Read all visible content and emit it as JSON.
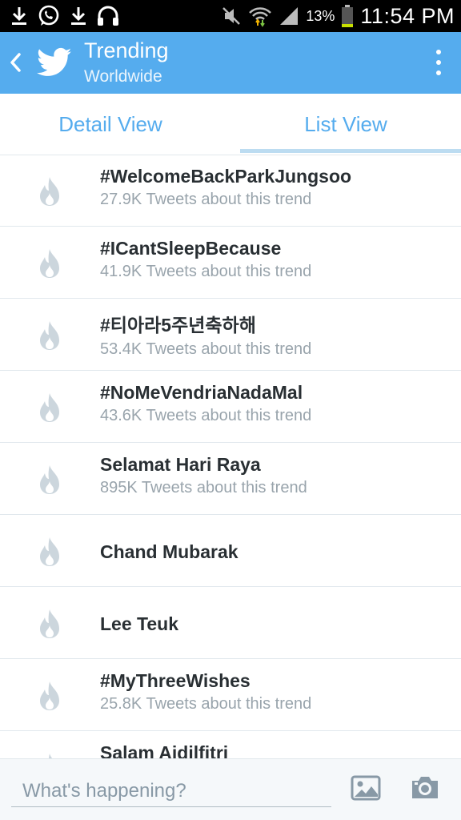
{
  "status_bar": {
    "battery_percent": "13%",
    "time": "11:54 PM",
    "icons": [
      "download-icon",
      "whatsapp-icon",
      "download-icon",
      "headphones-icon",
      "mute-icon",
      "wifi-icon",
      "signal-icon",
      "battery-icon"
    ]
  },
  "header": {
    "title": "Trending",
    "subtitle": "Worldwide"
  },
  "tabs": [
    {
      "label": "Detail View",
      "selected": false
    },
    {
      "label": "List View",
      "selected": true
    }
  ],
  "trends": [
    {
      "name": "#WelcomeBackParkJungsoo",
      "count": "27.9K Tweets about this trend"
    },
    {
      "name": "#ICantSleepBecause",
      "count": "41.9K Tweets about this trend"
    },
    {
      "name": "#티아라5주년축하해",
      "count": "53.4K Tweets about this trend"
    },
    {
      "name": "#NoMeVendriaNadaMal",
      "count": "43.6K Tweets about this trend"
    },
    {
      "name": "Selamat Hari Raya",
      "count": "895K Tweets about this trend"
    },
    {
      "name": "Chand Mubarak",
      "count": ""
    },
    {
      "name": "Lee Teuk",
      "count": ""
    },
    {
      "name": "#MyThreeWishes",
      "count": "25.8K Tweets about this trend"
    },
    {
      "name": "Salam Aidilfitri",
      "count": ""
    }
  ],
  "compose": {
    "placeholder": "What's happening?"
  },
  "colors": {
    "accent": "#55acee",
    "tab_indicator": "#bcdcf1",
    "trend_icon": "#ccd6dd"
  }
}
